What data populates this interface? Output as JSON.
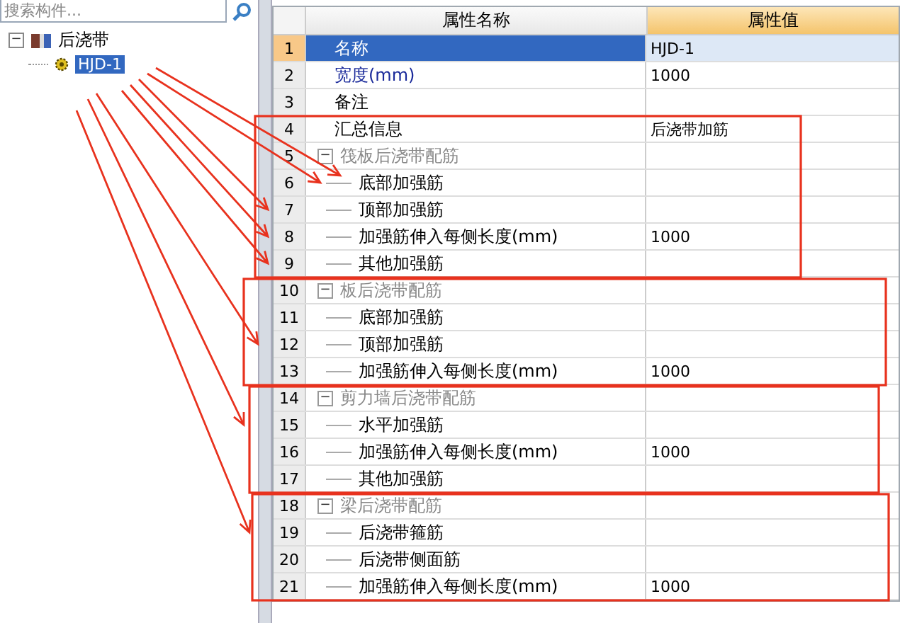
{
  "search": {
    "placeholder": "搜索构件..."
  },
  "tree": [
    {
      "label": "后浇带",
      "expanded": true,
      "expander": "−",
      "children": [
        {
          "label": "HJD-1",
          "selected": true
        }
      ]
    }
  ],
  "grid": {
    "columns": [
      "属性名称",
      "属性值"
    ],
    "rows": [
      {
        "num": "1",
        "kind": "property",
        "name": "名称",
        "value": "HJD-1",
        "selected": true,
        "emphasized": false
      },
      {
        "num": "2",
        "kind": "property",
        "name": "宽度(mm)",
        "value": "1000",
        "selected": false,
        "emphasized": true
      },
      {
        "num": "3",
        "kind": "property",
        "name": "备注",
        "selected": false,
        "emphasized": false
      },
      {
        "num": "4",
        "kind": "property",
        "name": "汇总信息",
        "value": "后浇带加筋",
        "selected": false,
        "emphasized": false
      },
      {
        "num": "5",
        "kind": "group",
        "name": "筏板后浇带配筋",
        "expander": "−",
        "selected": false,
        "emphasized": false
      },
      {
        "num": "6",
        "kind": "child",
        "name": "底部加强筋",
        "selected": false,
        "emphasized": false
      },
      {
        "num": "7",
        "kind": "child",
        "name": "顶部加强筋",
        "selected": false,
        "emphasized": false
      },
      {
        "num": "8",
        "kind": "child",
        "name": "加强筋伸入每侧长度(mm)",
        "value": "1000",
        "selected": false,
        "emphasized": false
      },
      {
        "num": "9",
        "kind": "child",
        "name": "其他加强筋",
        "selected": false,
        "emphasized": false
      },
      {
        "num": "10",
        "kind": "group",
        "name": "板后浇带配筋",
        "expander": "−",
        "selected": false,
        "emphasized": false
      },
      {
        "num": "11",
        "kind": "child",
        "name": "底部加强筋",
        "selected": false,
        "emphasized": false
      },
      {
        "num": "12",
        "kind": "child",
        "name": "顶部加强筋",
        "selected": false,
        "emphasized": false
      },
      {
        "num": "13",
        "kind": "child",
        "name": "加强筋伸入每侧长度(mm)",
        "value": "1000",
        "selected": false,
        "emphasized": false
      },
      {
        "num": "14",
        "kind": "group",
        "name": "剪力墙后浇带配筋",
        "expander": "−",
        "selected": false,
        "emphasized": false
      },
      {
        "num": "15",
        "kind": "child",
        "name": "水平加强筋",
        "selected": false,
        "emphasized": false
      },
      {
        "num": "16",
        "kind": "child",
        "name": "加强筋伸入每侧长度(mm)",
        "value": "1000",
        "selected": false,
        "emphasized": false
      },
      {
        "num": "17",
        "kind": "child",
        "name": "其他加强筋",
        "selected": false,
        "emphasized": false
      },
      {
        "num": "18",
        "kind": "group",
        "name": "梁后浇带配筋",
        "expander": "−",
        "selected": false,
        "emphasized": false
      },
      {
        "num": "19",
        "kind": "child",
        "name": "后浇带箍筋",
        "selected": false,
        "emphasized": false
      },
      {
        "num": "20",
        "kind": "child",
        "name": "后浇带侧面筋",
        "selected": false,
        "emphasized": false
      },
      {
        "num": "21",
        "kind": "child",
        "name": "加强筋伸入每侧长度(mm)",
        "value": "1000",
        "selected": false,
        "emphasized": false
      }
    ]
  }
}
